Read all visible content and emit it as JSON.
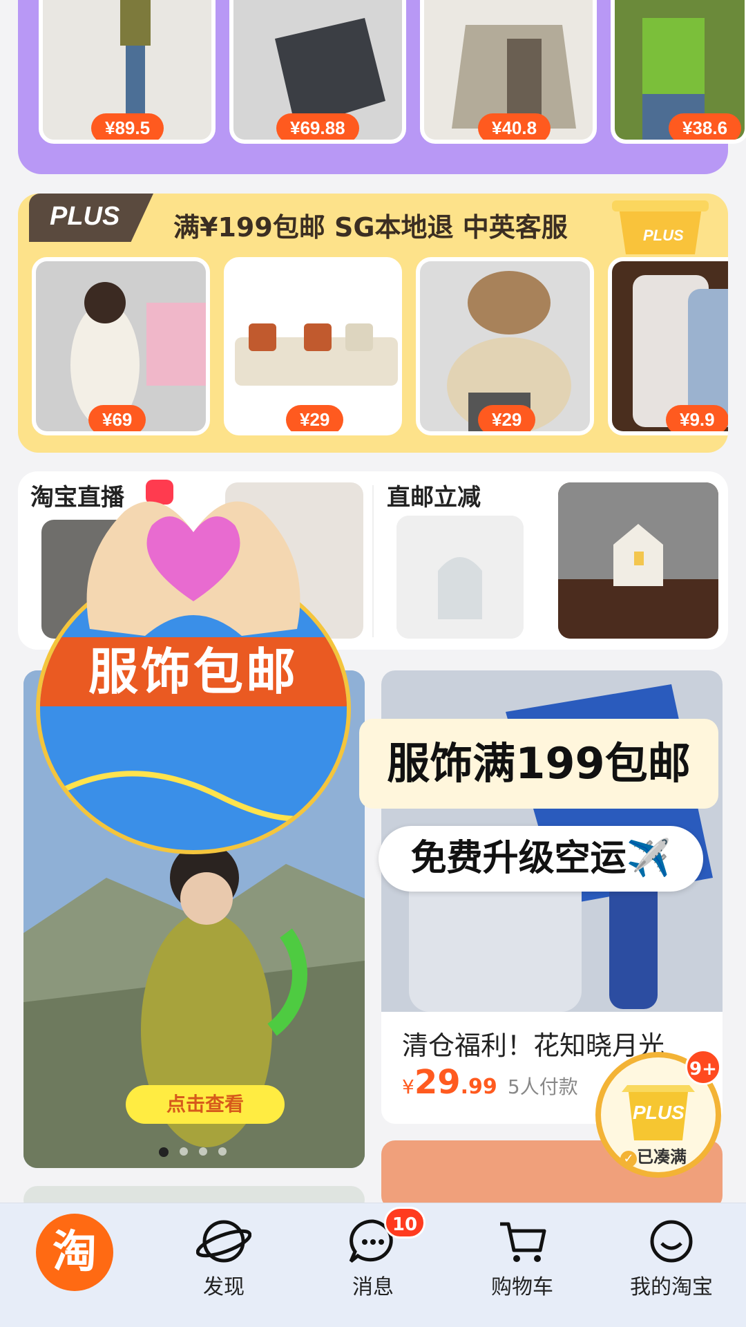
{
  "top_strip": {
    "items": [
      {
        "price": "¥89.5"
      },
      {
        "price": "¥69.88"
      },
      {
        "price": "¥40.8"
      },
      {
        "price": "¥38.6"
      }
    ]
  },
  "plus_section": {
    "badge": "PLUS",
    "banner": "满¥199包邮 SG本地退 中英客服",
    "cart_label": "PLUS",
    "items": [
      {
        "price": "¥69"
      },
      {
        "price": "¥29"
      },
      {
        "price": "¥29"
      },
      {
        "price": "¥9.9"
      }
    ]
  },
  "live": {
    "title": "淘宝直播",
    "mail_title": "直邮立减"
  },
  "promo": {
    "circle_text": "服饰包邮",
    "banner_big": "服饰满199包邮",
    "banner_small": "免费升级空运✈️",
    "cta": "点击查看"
  },
  "feed": {
    "right_card": {
      "title": "清仓福利！花知晓月光",
      "price_symbol": "¥",
      "price_int": "29",
      "price_dec": ".99",
      "sales": "5人付款"
    }
  },
  "float_cart": {
    "label": "PLUS",
    "status": "已凑满",
    "badge": "9+"
  },
  "bottom_nav": {
    "home_glyph": "淘",
    "items": [
      {
        "label": "发现",
        "icon": "planet-icon"
      },
      {
        "label": "消息",
        "icon": "chat-icon"
      },
      {
        "label": "购物车",
        "icon": "cart-icon"
      },
      {
        "label": "我的淘宝",
        "icon": "smile-icon"
      }
    ],
    "message_badge": "10"
  },
  "colors": {
    "accent": "#ff5a1f",
    "plus_yellow": "#fde28a",
    "top_purple": "#b898f5"
  }
}
